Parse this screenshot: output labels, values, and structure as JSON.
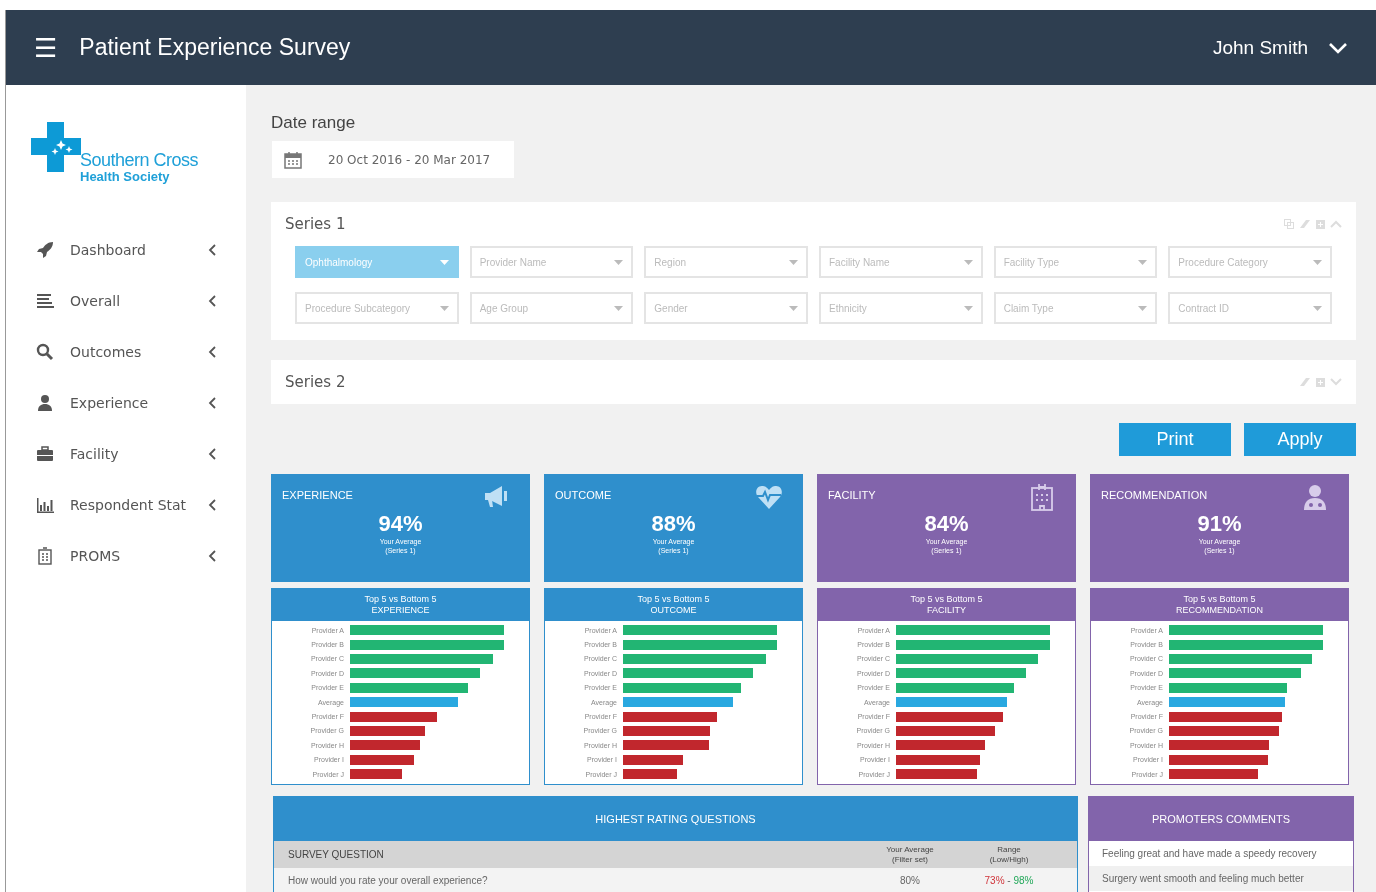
{
  "header": {
    "menu_icon": "☰",
    "title": "Patient Experience Survey",
    "user": "John Smith"
  },
  "sidebar": {
    "logo": {
      "line1": "Southern Cross",
      "line2": "Health Society"
    },
    "items": [
      {
        "label": "Dashboard",
        "selected": false
      },
      {
        "label": "Overall",
        "selected": false
      },
      {
        "label": "Outcomes",
        "selected": false
      },
      {
        "label": "Experience",
        "selected": false
      },
      {
        "label": "Facility",
        "selected": false
      },
      {
        "label": "Respondent Stat",
        "selected": false
      },
      {
        "label": "PROMS",
        "selected": false
      }
    ]
  },
  "date_range": {
    "label": "Date range",
    "value": "20 Oct 2016 - 20 Mar 2017"
  },
  "series": [
    {
      "title": "Series 1",
      "expanded": true,
      "filters": [
        {
          "placeholder": "Ophthalmology",
          "selected": true
        },
        {
          "placeholder": "Provider Name",
          "selected": false
        },
        {
          "placeholder": "Region",
          "selected": false
        },
        {
          "placeholder": "Facility Name",
          "selected": false
        },
        {
          "placeholder": "Facility Type",
          "selected": false
        },
        {
          "placeholder": "Procedure Category",
          "selected": false
        },
        {
          "placeholder": "Procedure Subcategory",
          "selected": false
        },
        {
          "placeholder": "Age Group",
          "selected": false
        },
        {
          "placeholder": "Gender",
          "selected": false
        },
        {
          "placeholder": "Ethnicity",
          "selected": false
        },
        {
          "placeholder": "Claim Type",
          "selected": false
        },
        {
          "placeholder": "Contract ID",
          "selected": false
        }
      ]
    },
    {
      "title": "Series 2",
      "expanded": false
    }
  ],
  "buttons": [
    "Print",
    "Apply"
  ],
  "cards": [
    {
      "title": "EXPERIENCE",
      "color": "#2f8fcc",
      "value": "94%",
      "caption": "Your Average",
      "sub": "(Series 1)",
      "chart_title": "Top 5 vs Bottom 5",
      "chart_subtitle": "EXPERIENCE",
      "bars": [
        {
          "label": "Provider A",
          "kind": "top"
        },
        {
          "label": "Provider B",
          "kind": "top"
        },
        {
          "label": "Provider C",
          "kind": "top"
        },
        {
          "label": "Provider D",
          "kind": "top"
        },
        {
          "label": "Provider E",
          "kind": "top"
        },
        {
          "label": "Average",
          "kind": "average"
        },
        {
          "label": "Provider F",
          "kind": "bottom"
        },
        {
          "label": "Provider G",
          "kind": "bottom"
        },
        {
          "label": "Provider H",
          "kind": "bottom"
        },
        {
          "label": "Provider I",
          "kind": "bottom"
        },
        {
          "label": "Provider J",
          "kind": "bottom"
        }
      ]
    },
    {
      "title": "OUTCOME",
      "color": "#2f8fcc",
      "value": "88%",
      "caption": "Your Average",
      "sub": "(Series 1)",
      "chart_title": "Top 5 vs Bottom 5",
      "chart_subtitle": "OUTCOME",
      "bars": [
        {
          "label": "Provider A",
          "kind": "top"
        },
        {
          "label": "Provider B",
          "kind": "top"
        },
        {
          "label": "Provider C",
          "kind": "top"
        },
        {
          "label": "Provider D",
          "kind": "top"
        },
        {
          "label": "Provider E",
          "kind": "top"
        },
        {
          "label": "Average",
          "kind": "average"
        },
        {
          "label": "Provider F",
          "kind": "bottom"
        },
        {
          "label": "Provider G",
          "kind": "bottom"
        },
        {
          "label": "Provider H",
          "kind": "bottom"
        },
        {
          "label": "Provider I",
          "kind": "bottom"
        },
        {
          "label": "Provider J",
          "kind": "bottom"
        }
      ]
    },
    {
      "title": "FACILITY",
      "color": "#8264ab",
      "value": "84%",
      "caption": "Your Average",
      "sub": "(Series 1)",
      "chart_title": "Top 5 vs Bottom 5",
      "chart_subtitle": "FACILITY",
      "bars": [
        {
          "label": "Provider A",
          "kind": "top"
        },
        {
          "label": "Provider B",
          "kind": "top"
        },
        {
          "label": "Provider C",
          "kind": "top"
        },
        {
          "label": "Provider D",
          "kind": "top"
        },
        {
          "label": "Provider E",
          "kind": "top"
        },
        {
          "label": "Average",
          "kind": "average"
        },
        {
          "label": "Provider F",
          "kind": "bottom"
        },
        {
          "label": "Provider G",
          "kind": "bottom"
        },
        {
          "label": "Provider H",
          "kind": "bottom"
        },
        {
          "label": "Provider I",
          "kind": "bottom"
        },
        {
          "label": "Provider J",
          "kind": "bottom"
        }
      ]
    },
    {
      "title": "RECOMMENDATION",
      "color": "#8264ab",
      "value": "91%",
      "caption": "Your Average",
      "sub": "(Series 1)",
      "chart_title": "Top 5 vs Bottom 5",
      "chart_subtitle": "RECOMMENDATION",
      "bars": [
        {
          "label": "Provider A",
          "kind": "top"
        },
        {
          "label": "Provider B",
          "kind": "top"
        },
        {
          "label": "Provider C",
          "kind": "top"
        },
        {
          "label": "Provider D",
          "kind": "top"
        },
        {
          "label": "Provider E",
          "kind": "top"
        },
        {
          "label": "Average",
          "kind": "average"
        },
        {
          "label": "Provider F",
          "kind": "bottom"
        },
        {
          "label": "Provider G",
          "kind": "bottom"
        },
        {
          "label": "Provider H",
          "kind": "bottom"
        },
        {
          "label": "Provider I",
          "kind": "bottom"
        },
        {
          "label": "Provider J",
          "kind": "bottom"
        }
      ]
    }
  ],
  "questions": {
    "title": "HIGHEST RATING QUESTIONS",
    "columns": [
      "SURVEY QUESTION",
      "Your Average\n(Filter set)",
      "Range\n(Low/High)"
    ],
    "rows": [
      {
        "question": "How would you rate your overall experience?",
        "average": "80%",
        "low": "73%",
        "separator": " - ",
        "high": "98%"
      }
    ]
  },
  "comments": {
    "title": "PROMOTERS COMMENTS",
    "items": [
      "Feeling great and have made a speedy recovery",
      "Surgery went smooth and feeling much better"
    ]
  }
}
